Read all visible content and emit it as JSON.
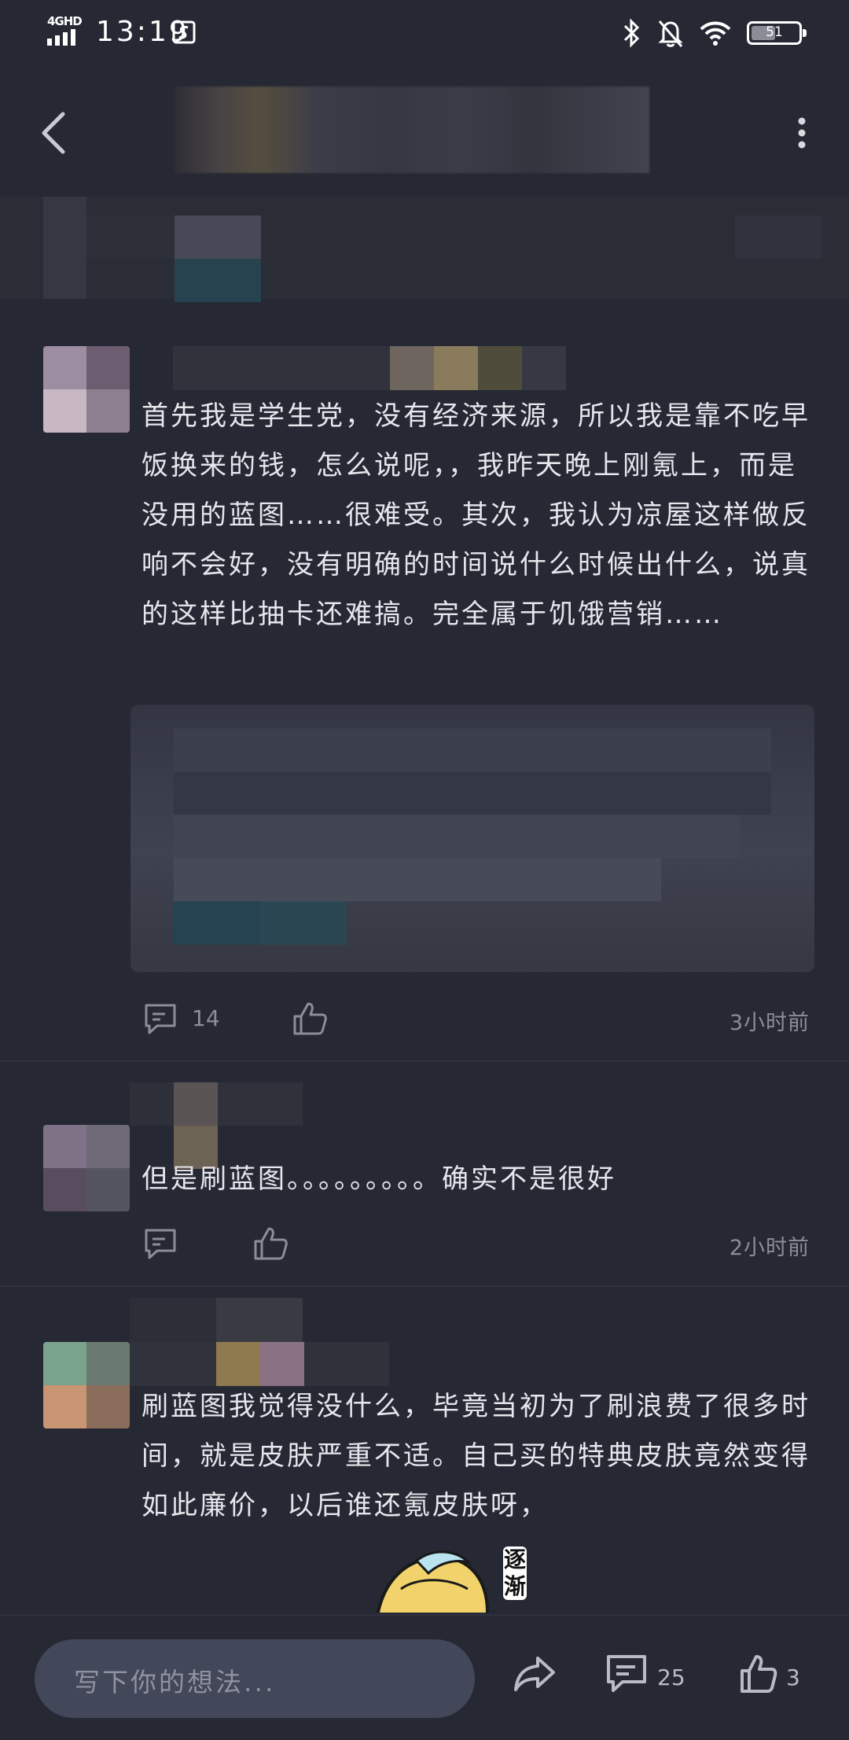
{
  "status_bar": {
    "network": "4GHD",
    "time": "13:19",
    "battery": "51",
    "battery_level": 0.51
  },
  "colors": {
    "background": "#262834",
    "text": "#e4e5ea",
    "muted": "#8b8d98",
    "input_bg": "#43475a"
  },
  "comments": [
    {
      "text": "首先我是学生党，没有经济来源，所以我是靠不吃早饭换来的钱，怎么说呢，，我昨天晚上刚氪上，而是没用的蓝图……很难受。其次，我认为凉屋这样做反响不会好，没有明确的时间说什么时候出什么，说真的这样比抽卡还难搞。完全属于饥饿营销……",
      "reply_count": "14",
      "time": "3小时前"
    },
    {
      "text": "但是刷蓝图。。。。。。。。。确实不是很好",
      "time": "2小时前"
    },
    {
      "text": "刷蓝图我觉得没什么，毕竟当初为了刷浪费了很多时间，就是皮肤严重不适。自己买的特典皮肤竟然变得如此廉价，以后谁还氪皮肤呀，"
    }
  ],
  "sticker": {
    "text": "逐渐"
  },
  "bottom_bar": {
    "input_placeholder": "写下你的想法...",
    "comment_count": "25",
    "like_count": "3"
  },
  "icons": {
    "back": "back-arrow-icon",
    "more": "more-vertical-icon",
    "reply": "reply-bubble-icon",
    "like": "thumbs-up-icon",
    "share": "share-icon",
    "comment": "comment-icon"
  }
}
